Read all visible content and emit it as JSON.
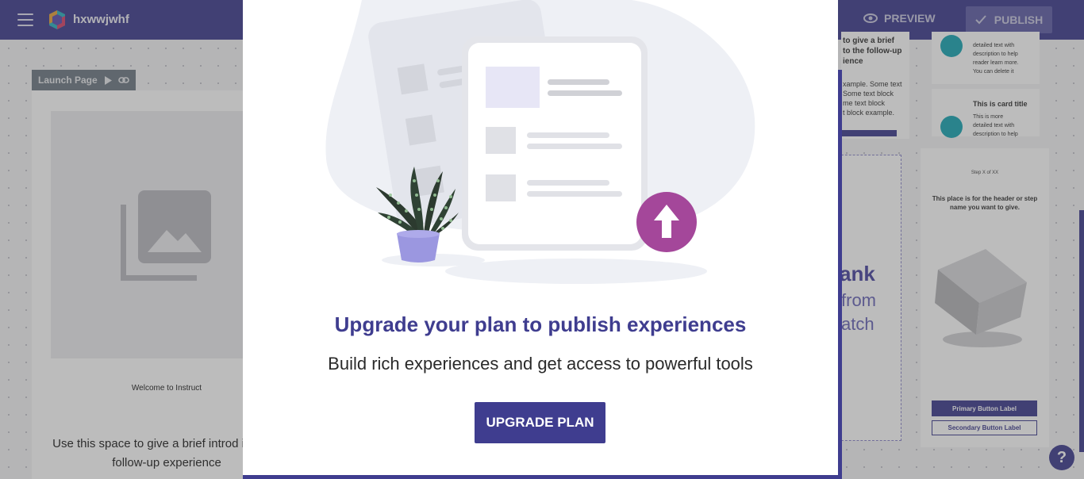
{
  "header": {
    "project_name": "hxwwjwhf",
    "preview_label": "PREVIEW",
    "publish_label": "PUBLISH"
  },
  "canvas": {
    "launch_tag": "Launch Page",
    "welcome_text": "Welcome to Instruct",
    "intro_text": "Use this space to give a brief introd into the follow-up experience"
  },
  "right_panel": {
    "top_left_lines": [
      "to give a brief",
      "to the follow-up",
      "ience",
      "xample. Some text",
      "Some text block",
      "me text block",
      "t block example."
    ],
    "card1_text": [
      "detailed text with",
      "description to help",
      "reader learn more.",
      "You can delete it"
    ],
    "card2_title": "This is card title",
    "card2_text": [
      "This is more",
      "detailed text with",
      "description to help"
    ],
    "blank_title": "ank",
    "blank_sub1": "from",
    "blank_sub2": "atch",
    "step_label": "Step X of XX",
    "step_header": "This place is for the header or step name you want to give.",
    "primary_button": "Primary Button Label",
    "secondary_button": "Secondary Button Label",
    "help_label": "?"
  },
  "modal": {
    "title": "Upgrade your plan to publish experiences",
    "subtitle": "Build rich experiences and get access to powerful tools",
    "button_label": "UPGRADE PLAN"
  },
  "colors": {
    "brand": "#3f3d8f",
    "upload_circle": "#a4479a",
    "teal": "#1ba7b5",
    "pot": "#9b97e0"
  }
}
